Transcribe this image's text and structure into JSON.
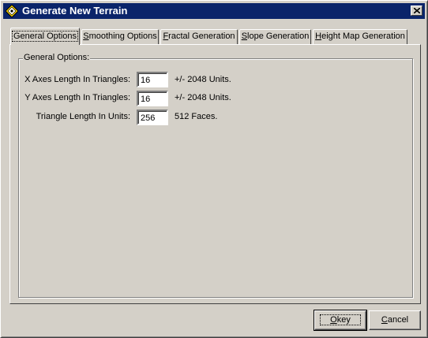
{
  "window": {
    "title": "Generate New Terrain",
    "icon": "app-diamond-icon",
    "close_label": "close-icon"
  },
  "tabs": [
    {
      "label": "General Options",
      "mnemonic": "",
      "active": true
    },
    {
      "label": "Smoothing Options",
      "mnemonic": "S",
      "active": false
    },
    {
      "label": "Fractal Generation",
      "mnemonic": "F",
      "active": false
    },
    {
      "label": "Slope Generation",
      "mnemonic": "S",
      "active": false
    },
    {
      "label": "Height Map Generation",
      "mnemonic": "H",
      "active": false
    }
  ],
  "general": {
    "group_label": "General Options:",
    "rows": [
      {
        "label": "X Axes Length In Triangles:",
        "value": "16",
        "units": "+/- 2048 Units."
      },
      {
        "label": "Y Axes Length In Triangles:",
        "value": "16",
        "units": "+/- 2048 Units."
      },
      {
        "label": "Triangle Length In Units:",
        "value": "256",
        "units": "512 Faces."
      }
    ]
  },
  "buttons": {
    "ok": "Okey",
    "cancel": "Cancel"
  },
  "colors": {
    "titlebar": "#0a246a",
    "face": "#d4d0c8"
  }
}
